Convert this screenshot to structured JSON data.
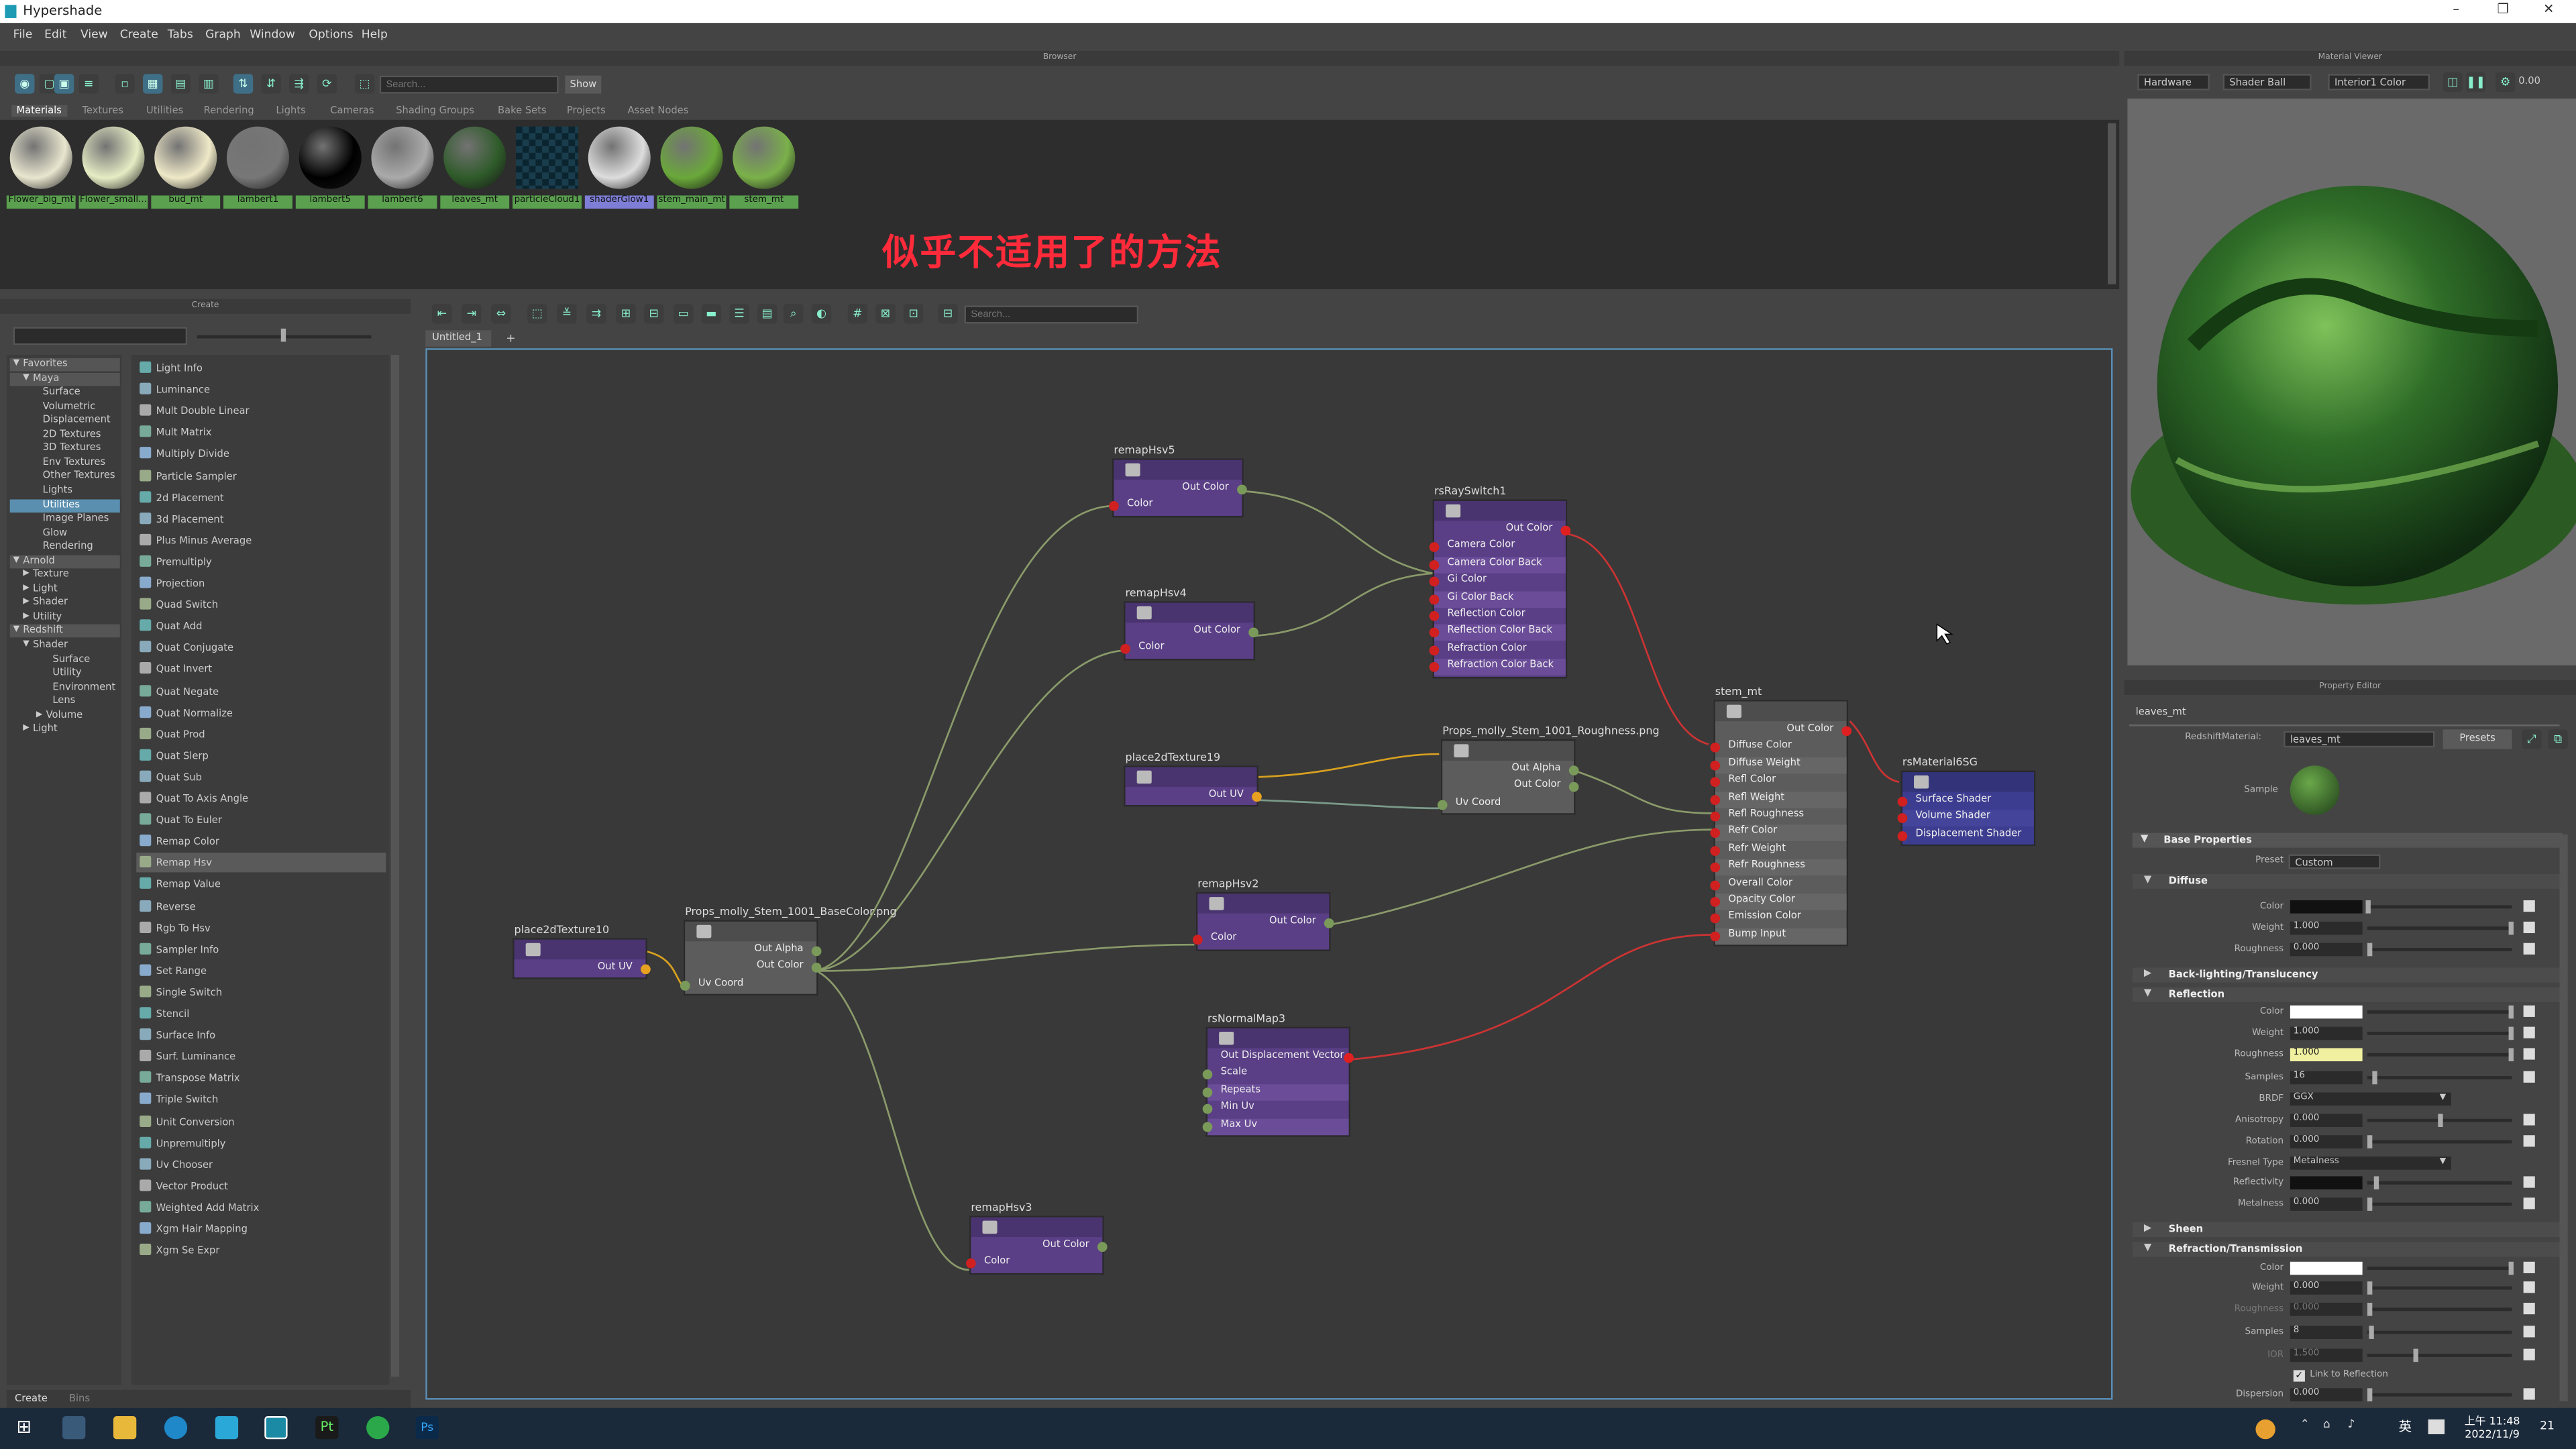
{
  "app": {
    "title": "Hypershade"
  },
  "menu": [
    "File",
    "Edit",
    "View",
    "Create",
    "Tabs",
    "Graph",
    "Window",
    "Options",
    "Help"
  ],
  "panels": {
    "browser": "Browser",
    "material_viewer": "Material Viewer",
    "create": "Create",
    "property_editor": "Property Editor"
  },
  "browser": {
    "search_placeholder": "Search...",
    "show_label": "Show",
    "tabs": [
      "Materials",
      "Textures",
      "Utilities",
      "Rendering",
      "Lights",
      "Cameras",
      "Shading Groups",
      "Bake Sets",
      "Projects",
      "Asset Nodes"
    ],
    "swatches": [
      {
        "name": "Flower_big_mt",
        "color": "#e9e6cf"
      },
      {
        "name": "Flower_small...",
        "color": "#e6ecc4"
      },
      {
        "name": "bud_mt",
        "color": "#efe9c8"
      },
      {
        "name": "lambert1",
        "color": "#777777"
      },
      {
        "name": "lambert5",
        "color": "#000000"
      },
      {
        "name": "lambert6",
        "color": "#aaaaaa"
      },
      {
        "name": "leaves_mt",
        "color": "#2f5b2a"
      },
      {
        "name": "particleCloud1",
        "color": "#1a3d4d"
      },
      {
        "name": "shaderGlow1",
        "color": "#dddddd"
      },
      {
        "name": "stem_main_mt",
        "color": "#6aa83a"
      },
      {
        "name": "stem_mt",
        "color": "#7ab04a"
      }
    ]
  },
  "subtitle": "似乎不适用了的方法",
  "viewer": {
    "renderer": "Hardware",
    "shape": "Shader Ball",
    "env": "Interior1 Color",
    "exposure": "0.00"
  },
  "create_tree": [
    "Favorites",
    "Maya",
    "Surface",
    "Volumetric",
    "Displacement",
    "2D Textures",
    "3D Textures",
    "Env Textures",
    "Other Textures",
    "Lights",
    "Utilities",
    "Image Planes",
    "Glow",
    "Rendering",
    "Arnold",
    "Texture",
    "Light",
    "Shader",
    "Utility",
    "Redshift",
    "Shader",
    "Surface",
    "Utility",
    "Environment",
    "Lens",
    "Volume",
    "Light"
  ],
  "create_list": [
    "Light Info",
    "Luminance",
    "Mult Double Linear",
    "Mult Matrix",
    "Multiply Divide",
    "Particle Sampler",
    "2d Placement",
    "3d Placement",
    "Plus Minus Average",
    "Premultiply",
    "Projection",
    "Quad Switch",
    "Quat Add",
    "Quat Conjugate",
    "Quat Invert",
    "Quat Negate",
    "Quat Normalize",
    "Quat Prod",
    "Quat Slerp",
    "Quat Sub",
    "Quat To Axis Angle",
    "Quat To Euler",
    "Remap Color",
    "Remap Hsv",
    "Remap Value",
    "Reverse",
    "Rgb To Hsv",
    "Sampler Info",
    "Set Range",
    "Single Switch",
    "Stencil",
    "Surface Info",
    "Surf. Luminance",
    "Transpose Matrix",
    "Triple Switch",
    "Unit Conversion",
    "Unpremultiply",
    "Uv Chooser",
    "Vector Product",
    "Weighted Add Matrix",
    "Xgm Hair Mapping",
    "Xgm Se Expr"
  ],
  "graph": {
    "tab": "Untitled_1",
    "add_tab": "+",
    "search_placeholder": "Search...",
    "nodes": {
      "remapHsv5": {
        "title": "remapHsv5",
        "out": "Out Color",
        "inputs": [
          "Color"
        ]
      },
      "remapHsv4": {
        "title": "remapHsv4",
        "out": "Out Color",
        "inputs": [
          "Color"
        ]
      },
      "rsRaySwitch1": {
        "title": "rsRaySwitch1",
        "out": "Out Color",
        "inputs": [
          "Camera Color",
          "Camera Color Back",
          "Gi Color",
          "Gi Color Back",
          "Reflection Color",
          "Reflection Color Back",
          "Refraction Color",
          "Refraction Color Back"
        ]
      },
      "place2dTexture19": {
        "title": "place2dTexture19",
        "out": "Out UV"
      },
      "roughness": {
        "title": "Props_molly_Stem_1001_Roughness.png",
        "outs": [
          "Out Alpha",
          "Out Color"
        ],
        "inputs": [
          "Uv Coord"
        ]
      },
      "stem_mt": {
        "title": "stem_mt",
        "out": "Out Color",
        "inputs": [
          "Diffuse Color",
          "Diffuse Weight",
          "Refl Color",
          "Refl Weight",
          "Refl Roughness",
          "Refr Color",
          "Refr Weight",
          "Refr Roughness",
          "Overall Color",
          "Opacity Color",
          "Emission Color",
          "Bump Input"
        ]
      },
      "rsMaterial6SG": {
        "title": "rsMaterial6SG",
        "inputs": [
          "Surface Shader",
          "Volume Shader",
          "Displacement Shader"
        ]
      },
      "place2dTexture10": {
        "title": "place2dTexture10",
        "out": "Out UV"
      },
      "basecolor": {
        "title": "Props_molly_Stem_1001_BaseColor.png",
        "outs": [
          "Out Alpha",
          "Out Color"
        ],
        "inputs": [
          "Uv Coord"
        ]
      },
      "remapHsv2": {
        "title": "remapHsv2",
        "out": "Out Color",
        "inputs": [
          "Color"
        ]
      },
      "rsNormalMap3": {
        "title": "rsNormalMap3",
        "out": "Out Displacement Vector",
        "inputs": [
          "Scale",
          "Repeats",
          "Min Uv",
          "Max Uv"
        ]
      },
      "remapHsv3": {
        "title": "remapHsv3",
        "out": "Out Color",
        "inputs": [
          "Color"
        ]
      }
    }
  },
  "property": {
    "tab": "leaves_mt",
    "material_label": "RedshiftMaterial:",
    "material_name": "leaves_mt",
    "presets": "Presets",
    "sample_label": "Sample",
    "base_properties": "Base Properties",
    "preset_label": "Preset",
    "preset_value": "Custom",
    "diffuse": {
      "title": "Diffuse",
      "color_label": "Color",
      "color": "#111111",
      "weight_label": "Weight",
      "weight": "1.000",
      "rough_label": "Roughness",
      "roughness": "0.000"
    },
    "backlighting": "Back-lighting/Translucency",
    "reflection": {
      "title": "Reflection",
      "color_label": "Color",
      "color": "#ffffff",
      "weight_label": "Weight",
      "weight": "1.000",
      "rough_label": "Roughness",
      "roughness": "1.000",
      "samples_label": "Samples",
      "samples": "16",
      "brdf_label": "BRDF",
      "brdf": "GGX",
      "aniso_label": "Anisotropy",
      "anisotropy": "0.000",
      "rot_label": "Rotation",
      "rotation": "0.000",
      "fresnel_label": "Fresnel Type",
      "fresnel": "Metalness",
      "reflectivity_label": "Reflectivity",
      "reflectivity": "#111111",
      "metal_label": "Metalness",
      "metalness": "0.000"
    },
    "sheen": "Sheen",
    "refraction": {
      "title": "Refraction/Transmission",
      "color_label": "Color",
      "color": "#ffffff",
      "weight_label": "Weight",
      "weight": "0.000",
      "rough_label": "Roughness",
      "roughness": "0.000",
      "samples_label": "Samples",
      "samples": "8",
      "ior_label": "IOR",
      "ior": "1.500",
      "link_label": "Link to Reflection",
      "disp_label": "Dispersion",
      "dispersion": "0.000"
    }
  },
  "bottom_tabs": [
    "Create",
    "Bins"
  ],
  "taskbar": {
    "time": "上午 11:48",
    "date": "2022/11/9",
    "ime": "英",
    "badge": "21"
  }
}
